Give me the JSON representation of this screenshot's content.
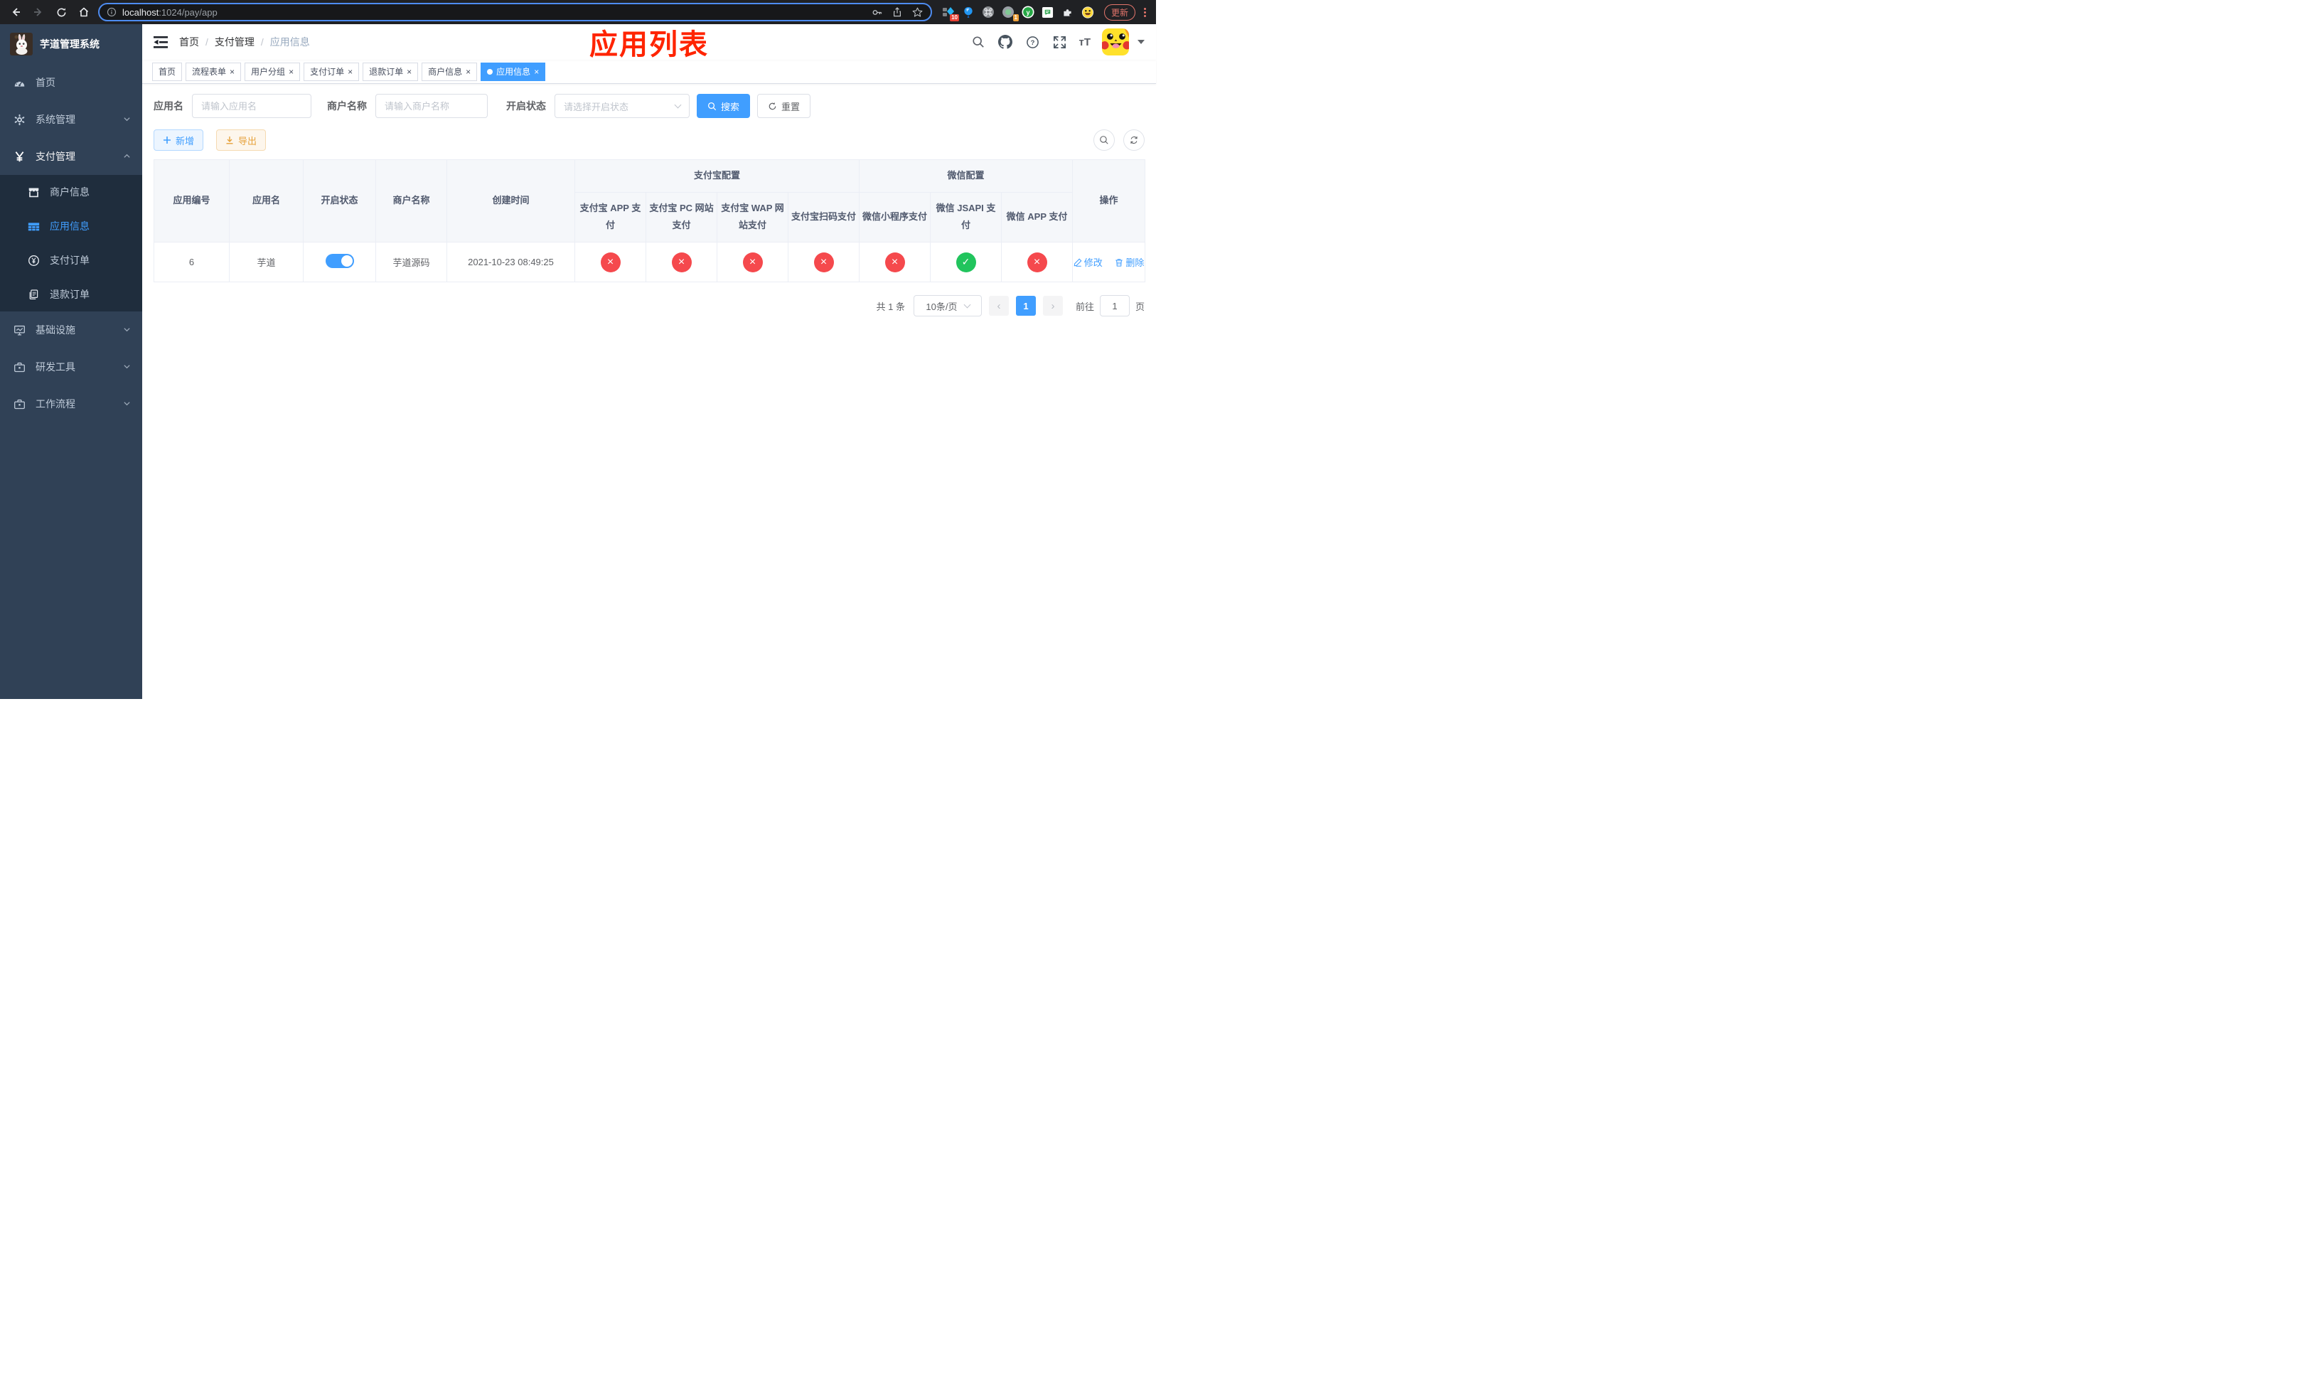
{
  "browser": {
    "url_host": "localhost",
    "url_rest": ":1024/pay/app",
    "ext_badge_blocker": "10",
    "ext_badge_recorder": "1",
    "update_label": "更新"
  },
  "sidebar": {
    "title": "芋道管理系统",
    "menu": [
      {
        "label": "首页",
        "icon": "dashboard-icon"
      },
      {
        "label": "系统管理",
        "icon": "gear-icon"
      },
      {
        "label": "支付管理",
        "icon": "yen-icon"
      }
    ],
    "submenu": [
      {
        "label": "商户信息",
        "icon": "shop-icon"
      },
      {
        "label": "应用信息",
        "icon": "grid-icon",
        "active": true
      },
      {
        "label": "支付订单",
        "icon": "yen-circle-icon"
      },
      {
        "label": "退款订单",
        "icon": "document-icon"
      }
    ],
    "menu_bottom": [
      {
        "label": "基础设施",
        "icon": "monitor-icon"
      },
      {
        "label": "研发工具",
        "icon": "toolbox-icon"
      },
      {
        "label": "工作流程",
        "icon": "toolbox-icon"
      }
    ]
  },
  "navbar": {
    "breadcrumb": [
      "首页",
      "支付管理",
      "应用信息"
    ],
    "annotation": "应用列表"
  },
  "tabs": [
    {
      "label": "首页"
    },
    {
      "label": "流程表单"
    },
    {
      "label": "用户分组"
    },
    {
      "label": "支付订单"
    },
    {
      "label": "退款订单"
    },
    {
      "label": "商户信息"
    },
    {
      "label": "应用信息"
    }
  ],
  "filters": {
    "app_name": {
      "label": "应用名",
      "placeholder": "请输入应用名"
    },
    "merchant_name": {
      "label": "商户名称",
      "placeholder": "请输入商户名称"
    },
    "status": {
      "label": "开启状态",
      "placeholder": "请选择开启状态"
    },
    "search_label": "搜索",
    "reset_label": "重置"
  },
  "toolbar": {
    "add_label": "新增",
    "export_label": "导出"
  },
  "table": {
    "main_headers": [
      "应用编号",
      "应用名",
      "开启状态",
      "商户名称",
      "创建时间"
    ],
    "group_headers": [
      "支付宝配置",
      "微信配置"
    ],
    "sub_headers": [
      "支付宝 APP 支付",
      "支付宝 PC 网站支付",
      "支付宝 WAP 网站支付",
      "支付宝扫码支付",
      "微信小程序支付",
      "微信 JSAPI 支付",
      "微信 APP 支付"
    ],
    "ops_header": "操作",
    "row": {
      "id": "6",
      "name": "芋道",
      "enabled": "on",
      "merchant": "芋道源码",
      "created_at": "2021-10-23 08:49:25",
      "statuses": [
        "error",
        "error",
        "error",
        "error",
        "error",
        "success",
        "error"
      ],
      "edit_label": "修改",
      "delete_label": "删除"
    }
  },
  "pagination": {
    "total": "共 1 条",
    "page_size": "10条/页",
    "current_page": "1",
    "goto_label": "前往",
    "goto_value": "1",
    "unit_label": "页"
  },
  "colors": {
    "primary": "#409eff",
    "success": "#21c45d",
    "danger": "#f5494d",
    "warning": "#e6a23c",
    "sidebar_bg": "#304156",
    "submenu_bg": "#1f2d3d",
    "annotation": "#ff2400"
  }
}
